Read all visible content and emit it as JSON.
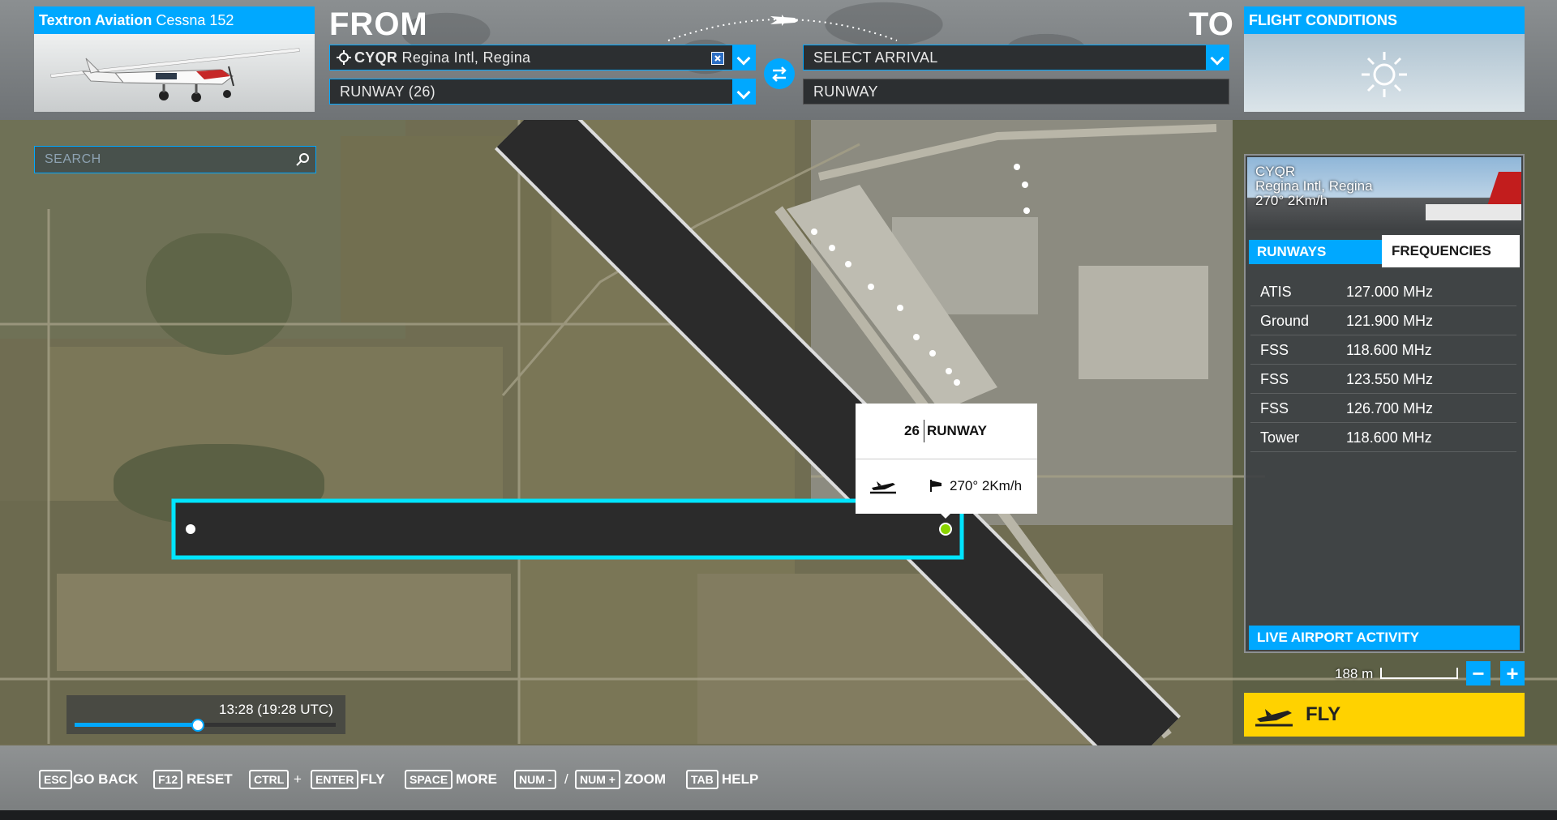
{
  "aircraft": {
    "brand": "Textron Aviation",
    "model": "Cessna 152"
  },
  "from": {
    "label": "FROM",
    "airport_code": "CYQR",
    "airport_name": "Regina Intl, Regina",
    "runway": "RUNWAY (26)"
  },
  "to": {
    "label": "TO",
    "arrival_placeholder": "SELECT ARRIVAL",
    "runway": "RUNWAY"
  },
  "flight_conditions": {
    "title": "FLIGHT CONDITIONS",
    "icon": "sun-icon"
  },
  "search": {
    "placeholder": "SEARCH"
  },
  "runway_popup": {
    "number": "26",
    "label": "RUNWAY",
    "wind": "270° 2Km/h",
    "icons": [
      "takeoff-icon",
      "windsock-icon"
    ]
  },
  "airport_panel": {
    "code": "CYQR",
    "name": "Regina Intl, Regina",
    "wind": "270° 2Km/h",
    "tabs": [
      {
        "label": "RUNWAYS",
        "active": false
      },
      {
        "label": "FREQUENCIES",
        "active": true
      }
    ],
    "frequencies": [
      {
        "name": "ATIS",
        "value": "127.000 MHz"
      },
      {
        "name": "Ground",
        "value": "121.900 MHz"
      },
      {
        "name": "FSS",
        "value": "118.600 MHz"
      },
      {
        "name": "FSS",
        "value": "123.550 MHz"
      },
      {
        "name": "FSS",
        "value": "126.700 MHz"
      },
      {
        "name": "Tower",
        "value": "118.600 MHz"
      }
    ],
    "live_activity": "LIVE AIRPORT ACTIVITY"
  },
  "map": {
    "scale": "188 m"
  },
  "time": {
    "text": "13:28 (19:28 UTC)",
    "progress": 0.47
  },
  "fly_button": {
    "label": "FLY"
  },
  "shortcuts": [
    {
      "key": "ESC",
      "action": "GO BACK"
    },
    {
      "key": "F12",
      "action": "RESET"
    },
    {
      "key": "CTRL",
      "plus": "+",
      "key2": "ENTER",
      "action": "FLY"
    },
    {
      "key": "SPACE",
      "action": "MORE"
    },
    {
      "key": "NUM -",
      "sep": "/",
      "key2": "NUM +",
      "action": "ZOOM"
    },
    {
      "key": "TAB",
      "action": "HELP"
    }
  ],
  "colors": {
    "accent": "#00a8ff",
    "fly": "#ffd200",
    "runway_highlight": "#00e5ff",
    "runway_end_active": "#8ad400"
  }
}
